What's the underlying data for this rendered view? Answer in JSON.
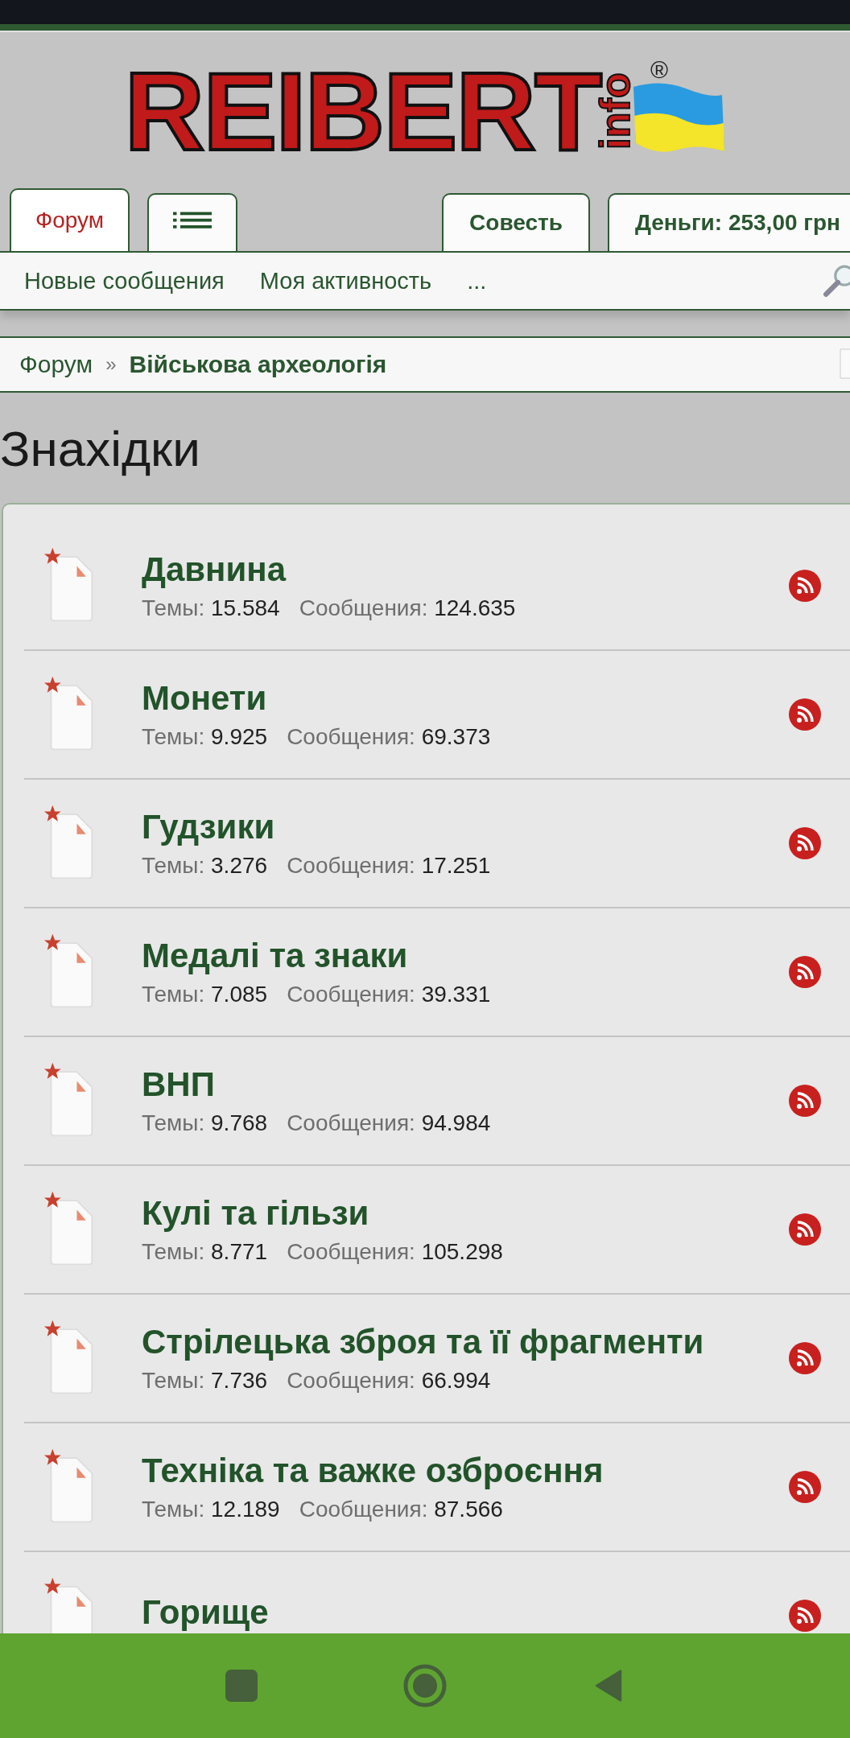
{
  "logo": {
    "name": "REIBERT",
    "suffix": "info",
    "mark": "®"
  },
  "tabs": [
    {
      "label": "Форум",
      "kind": "text",
      "selected": true
    },
    {
      "kind": "menu",
      "selected": false
    }
  ],
  "account_tabs": [
    "Совесть",
    "Деньги: 253,00 грн"
  ],
  "subnav": [
    "Новые сообщения",
    "Моя активность",
    "..."
  ],
  "breadcrumb": [
    {
      "label": "Форум",
      "current": false
    },
    {
      "label": "Військова археологія",
      "current": true
    }
  ],
  "breadcrumb_separator": "»",
  "page_title": "Знахідки",
  "forums": [
    {
      "title": "Давнина",
      "topics_label": "Темы:",
      "topics": "15.584",
      "messages_label": "Сообщения:",
      "messages": "124.635"
    },
    {
      "title": "Монети",
      "topics_label": "Темы:",
      "topics": "9.925",
      "messages_label": "Сообщения:",
      "messages": "69.373"
    },
    {
      "title": "Гудзики",
      "topics_label": "Темы:",
      "topics": "3.276",
      "messages_label": "Сообщения:",
      "messages": "17.251"
    },
    {
      "title": "Медалі та знаки",
      "topics_label": "Темы:",
      "topics": "7.085",
      "messages_label": "Сообщения:",
      "messages": "39.331"
    },
    {
      "title": "ВНП",
      "topics_label": "Темы:",
      "topics": "9.768",
      "messages_label": "Сообщения:",
      "messages": "94.984"
    },
    {
      "title": "Кулі та гільзи",
      "topics_label": "Темы:",
      "topics": "8.771",
      "messages_label": "Сообщения:",
      "messages": "105.298"
    },
    {
      "title": "Стрілецька зброя та її фрагменти",
      "topics_label": "Темы:",
      "topics": "7.736",
      "messages_label": "Сообщения:",
      "messages": "66.994"
    },
    {
      "title": "Техніка та важке озброєння",
      "topics_label": "Темы:",
      "topics": "12.189",
      "messages_label": "Сообщения:",
      "messages": "87.566"
    },
    {
      "title": "Горище"
    }
  ]
}
